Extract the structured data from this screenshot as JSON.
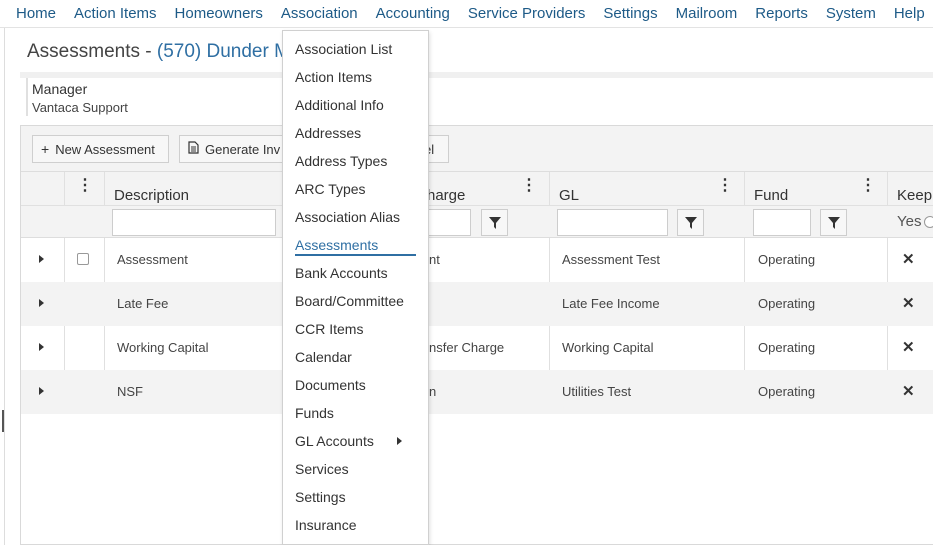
{
  "nav": [
    "Home",
    "Action Items",
    "Homeowners",
    "Association",
    "Accounting",
    "Service Providers",
    "Settings",
    "Mailroom",
    "Reports",
    "System",
    "Help"
  ],
  "page": {
    "title_prefix": "Assessments - ",
    "association": "(570) Dunder M"
  },
  "manager": {
    "label": "Manager",
    "value": "Vantaca Support"
  },
  "toolbar": {
    "new_assessment": "New Assessment",
    "generate_invoices": "Generate Inv",
    "excel_partial": "el"
  },
  "columns": {
    "description": "Description",
    "charge": "harge",
    "gl": "GL",
    "fund": "Fund",
    "keep": "Keep"
  },
  "filters": {
    "keep_value": "Yes"
  },
  "rows": [
    {
      "description": "Assessment",
      "charge": "nt",
      "gl": "Assessment Test",
      "fund": "Operating",
      "has_checkbox": true
    },
    {
      "description": "Late Fee",
      "charge": "",
      "gl": "Late Fee Income",
      "fund": "Operating",
      "has_checkbox": false
    },
    {
      "description": "Working Capital",
      "charge": "nsfer Charge",
      "gl": "Working Capital",
      "fund": "Operating",
      "has_checkbox": false
    },
    {
      "description": "NSF",
      "charge": "n",
      "gl": "Utilities Test",
      "fund": "Operating",
      "has_checkbox": false
    }
  ],
  "dropdown": {
    "items": [
      "Association List",
      "Action Items",
      "Additional Info",
      "Addresses",
      "Address Types",
      "ARC Types",
      "Association Alias",
      "Assessments",
      "Bank Accounts",
      "Board/Committee",
      "CCR Items",
      "Calendar",
      "Documents",
      "Funds",
      "GL Accounts",
      "Services",
      "Settings",
      "Insurance"
    ],
    "selected": "Assessments",
    "submenu_item": "GL Accounts"
  },
  "colors": {
    "accent": "#2f6fa3",
    "nav_text": "#1d5a87"
  }
}
